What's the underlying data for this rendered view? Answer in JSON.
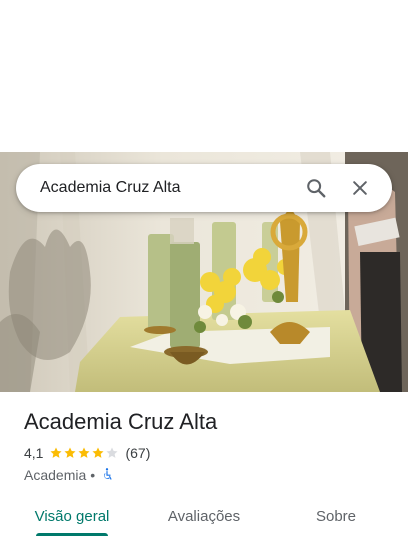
{
  "search": {
    "query": "Academia Cruz Alta",
    "search_icon": "search-icon",
    "close_icon": "close-icon"
  },
  "place": {
    "name": "Academia Cruz Alta",
    "rating": "4,1",
    "rating_value": 4.1,
    "stars_total": 5,
    "review_count": "(67)",
    "category": "Academia",
    "separator": "•",
    "accessibility_icon": "wheelchair-icon"
  },
  "tabs": [
    {
      "label": "Visão geral",
      "active": true
    },
    {
      "label": "Avaliações",
      "active": false
    },
    {
      "label": "Sobre",
      "active": false
    }
  ],
  "colors": {
    "accent": "#00796b",
    "star": "#fbbc04",
    "star_empty": "#dadce0",
    "accessibility": "#1a73e8"
  }
}
